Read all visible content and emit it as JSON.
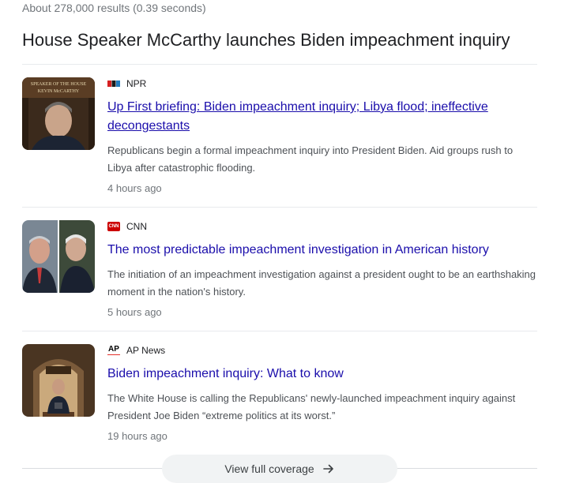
{
  "results_stats": "About 278,000 results (0.39 seconds)",
  "cluster_title": "House Speaker McCarthy launches Biden impeachment inquiry",
  "stories": [
    {
      "source": "NPR",
      "headline": "Up First briefing: Biden impeachment inquiry; Libya flood; ineffective decongestants",
      "snippet": "Republicans begin a formal impeachment inquiry into President Biden. Aid groups rush to Libya after catastrophic flooding.",
      "time": "4 hours ago",
      "thumb_sign": [
        "SPEAKER OF THE HOUSE",
        "KEVIN McCARTHY"
      ],
      "logo": "npr-logo-icon"
    },
    {
      "source": "CNN",
      "headline": "The most predictable impeachment investigation in American history",
      "snippet": "The initiation of an impeachment investigation against a president ought to be an earthshaking moment in the nation's history.",
      "time": "5 hours ago",
      "logo": "cnn-logo-icon",
      "logo_text": "CNN"
    },
    {
      "source": "AP News",
      "headline": "Biden impeachment inquiry: What to know",
      "snippet": "The White House is calling the Republicans' newly-launched impeachment inquiry against President Joe Biden “extreme politics at its worst.”",
      "time": "19 hours ago",
      "logo": "ap-logo-icon",
      "logo_text": "AP"
    }
  ],
  "view_full_coverage": "View full coverage",
  "colors": {
    "link": "#1a0dab",
    "snippet": "#4d5156",
    "meta": "#70757a",
    "button_bg": "#f1f3f4",
    "cnn_red": "#cc0000"
  }
}
